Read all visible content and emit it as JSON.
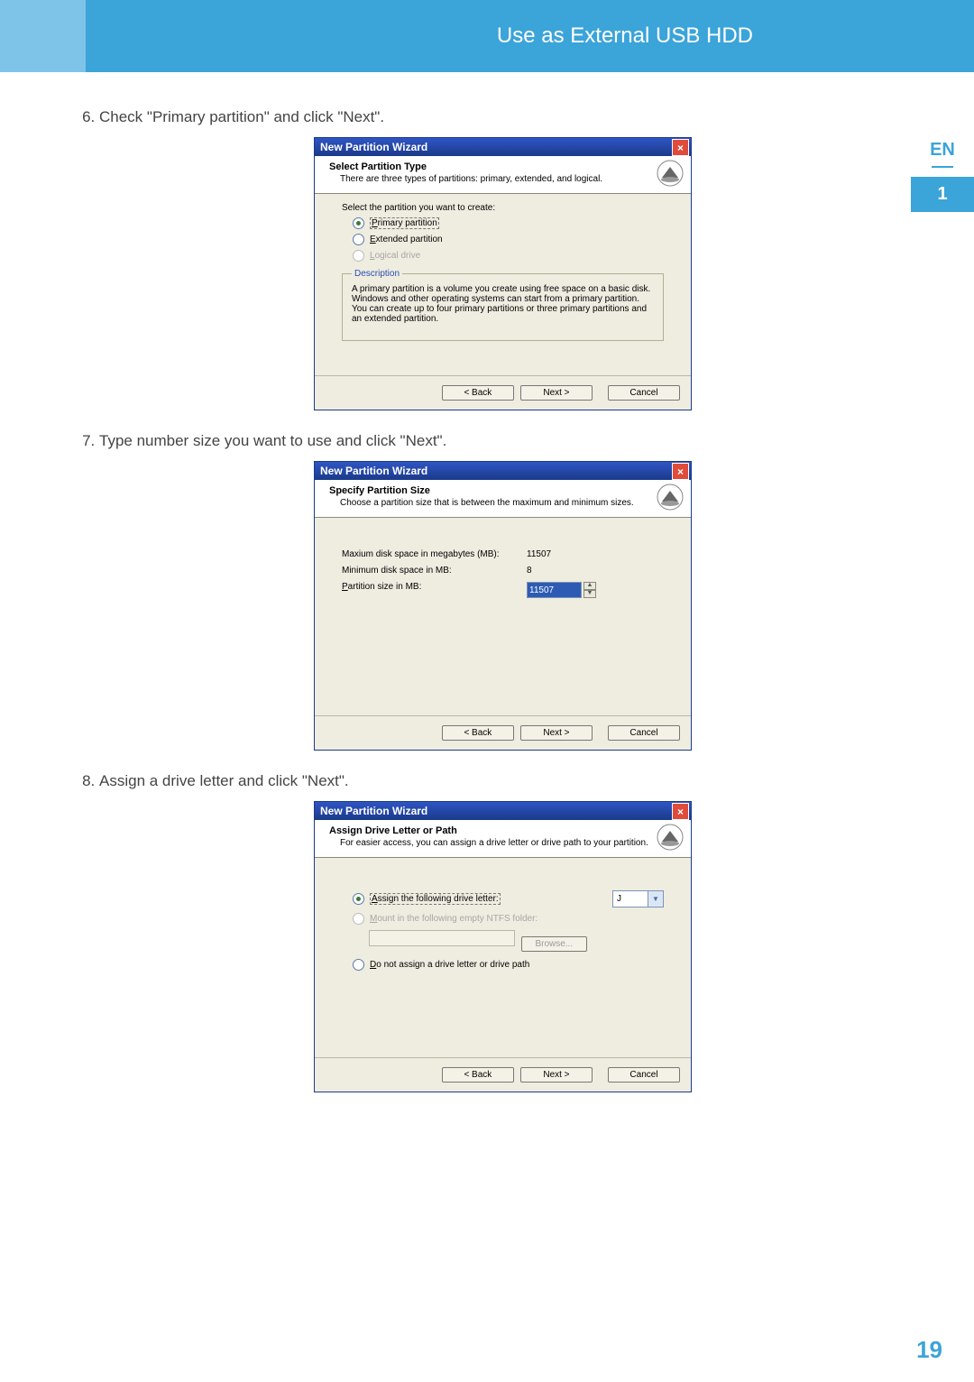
{
  "header": {
    "title": "Use as External USB HDD"
  },
  "sidebar": {
    "lang": "EN",
    "chapter": "1"
  },
  "page_number": "19",
  "steps": [
    {
      "num": "6.",
      "text": "Check \"Primary partition\" and click \"Next\"."
    },
    {
      "num": "7.",
      "text": "Type number size you want to use and click \"Next\"."
    },
    {
      "num": "8.",
      "text": "Assign a drive letter and click \"Next\"."
    }
  ],
  "wizard_common": {
    "title": "New Partition Wizard",
    "back": "< Back",
    "next": "Next >",
    "cancel": "Cancel"
  },
  "wiz1": {
    "heading": "Select Partition Type",
    "sub": "There are three types of partitions: primary, extended, and logical.",
    "prompt": "Select the partition you want to create:",
    "opt_primary": "Primary partition",
    "opt_extended": "Extended partition",
    "opt_logical": "Logical drive",
    "desc_legend": "Description",
    "desc_text": "A primary partition is a volume you create using free space on a basic disk. Windows and other operating systems can start from a primary partition. You can create up to four primary partitions or three primary partitions and an extended partition."
  },
  "wiz2": {
    "heading": "Specify Partition Size",
    "sub": "Choose a partition size that is between the maximum and minimum sizes.",
    "max_lbl": "Maxium disk space in megabytes (MB):",
    "max_val": "11507",
    "min_lbl": "Minimum disk space in MB:",
    "min_val": "8",
    "size_lbl": "Partition size in MB:",
    "size_val": "11507"
  },
  "wiz3": {
    "heading": "Assign Drive Letter or Path",
    "sub": "For easier access, you can assign a drive letter or drive path to your partition.",
    "opt_assign": "Assign the following drive letter:",
    "drive_letter": "J",
    "opt_mount": "Mount in the following empty NTFS folder:",
    "browse": "Browse...",
    "opt_none": "Do not assign a drive letter or drive path"
  }
}
